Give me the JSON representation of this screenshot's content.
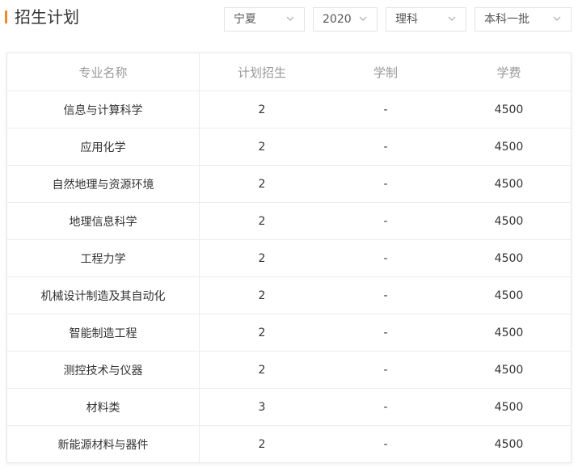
{
  "page": {
    "title": "招生计划"
  },
  "filters": [
    {
      "value": "宁夏"
    },
    {
      "value": "2020"
    },
    {
      "value": "理科"
    },
    {
      "value": "本科一批"
    }
  ],
  "table": {
    "headers": [
      "专业名称",
      "计划招生",
      "学制",
      "学费"
    ],
    "rows": [
      [
        "信息与计算科学",
        "2",
        "-",
        "4500"
      ],
      [
        "应用化学",
        "2",
        "-",
        "4500"
      ],
      [
        "自然地理与资源环境",
        "2",
        "-",
        "4500"
      ],
      [
        "地理信息科学",
        "2",
        "-",
        "4500"
      ],
      [
        "工程力学",
        "2",
        "-",
        "4500"
      ],
      [
        "机械设计制造及其自动化",
        "2",
        "-",
        "4500"
      ],
      [
        "智能制造工程",
        "2",
        "-",
        "4500"
      ],
      [
        "测控技术与仪器",
        "2",
        "-",
        "4500"
      ],
      [
        "材料类",
        "3",
        "-",
        "4500"
      ],
      [
        "新能源材料与器件",
        "2",
        "-",
        "4500"
      ]
    ]
  },
  "colors": {
    "accent": "#f08a24"
  },
  "icons": {
    "dropdown": "chevron-down-icon"
  }
}
